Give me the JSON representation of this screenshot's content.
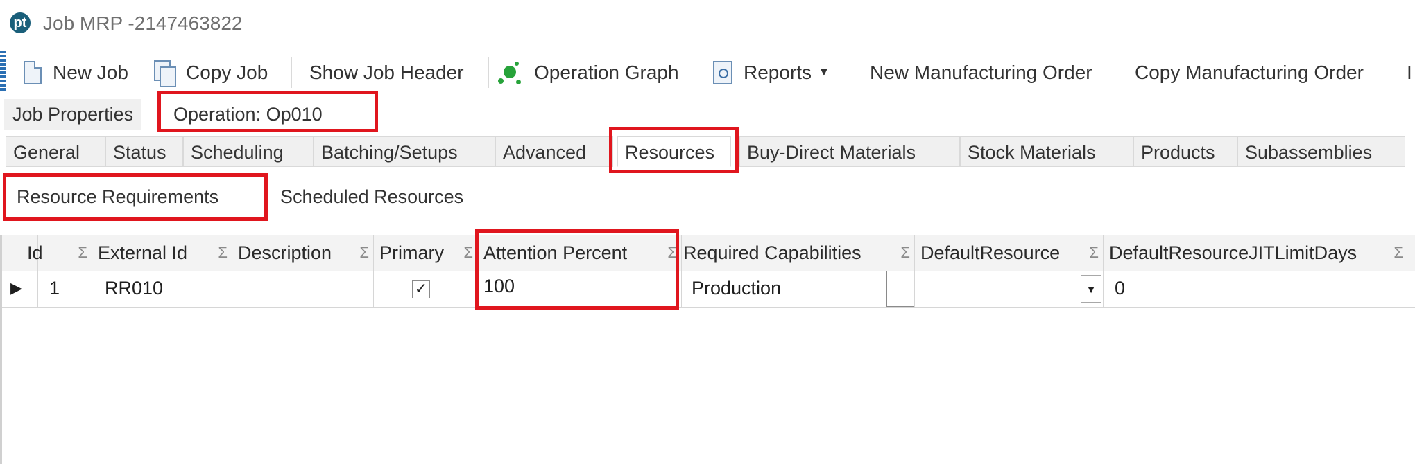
{
  "window": {
    "title": "Job MRP -2147463822",
    "logo": "pt"
  },
  "toolbar": {
    "new_job": "New Job",
    "copy_job": "Copy Job",
    "show_job_header": "Show Job Header",
    "operation_graph": "Operation Graph",
    "reports": "Reports",
    "new_mo": "New Manufacturing Order",
    "copy_mo": "Copy Manufacturing Order",
    "overflow": "I"
  },
  "properties": {
    "job_properties": "Job Properties",
    "operation": "Operation: Op010"
  },
  "tabs": [
    "General",
    "Status",
    "Scheduling",
    "Batching/Setups",
    "Advanced",
    "Resources",
    "Buy-Direct Materials",
    "Stock Materials",
    "Products",
    "Subassemblies"
  ],
  "active_tab": "Resources",
  "sub_tabs": [
    "Resource Requirements",
    "Scheduled Resources"
  ],
  "grid": {
    "sigma": "Σ",
    "columns": [
      "Id",
      "External Id",
      "Description",
      "Primary",
      "Attention Percent",
      "Required Capabilities",
      "DefaultResource",
      "DefaultResourceJITLimitDays"
    ],
    "rows": [
      {
        "indicator": "▶",
        "id": "1",
        "external_id": "RR010",
        "description": "",
        "primary": "✓",
        "attention_percent": "100",
        "required_capabilities": "Production",
        "default_resource": "",
        "jit_limit_days": "0"
      }
    ]
  },
  "colors": {
    "highlight": "#e0161e",
    "tab_bg": "#f0f0f0"
  }
}
